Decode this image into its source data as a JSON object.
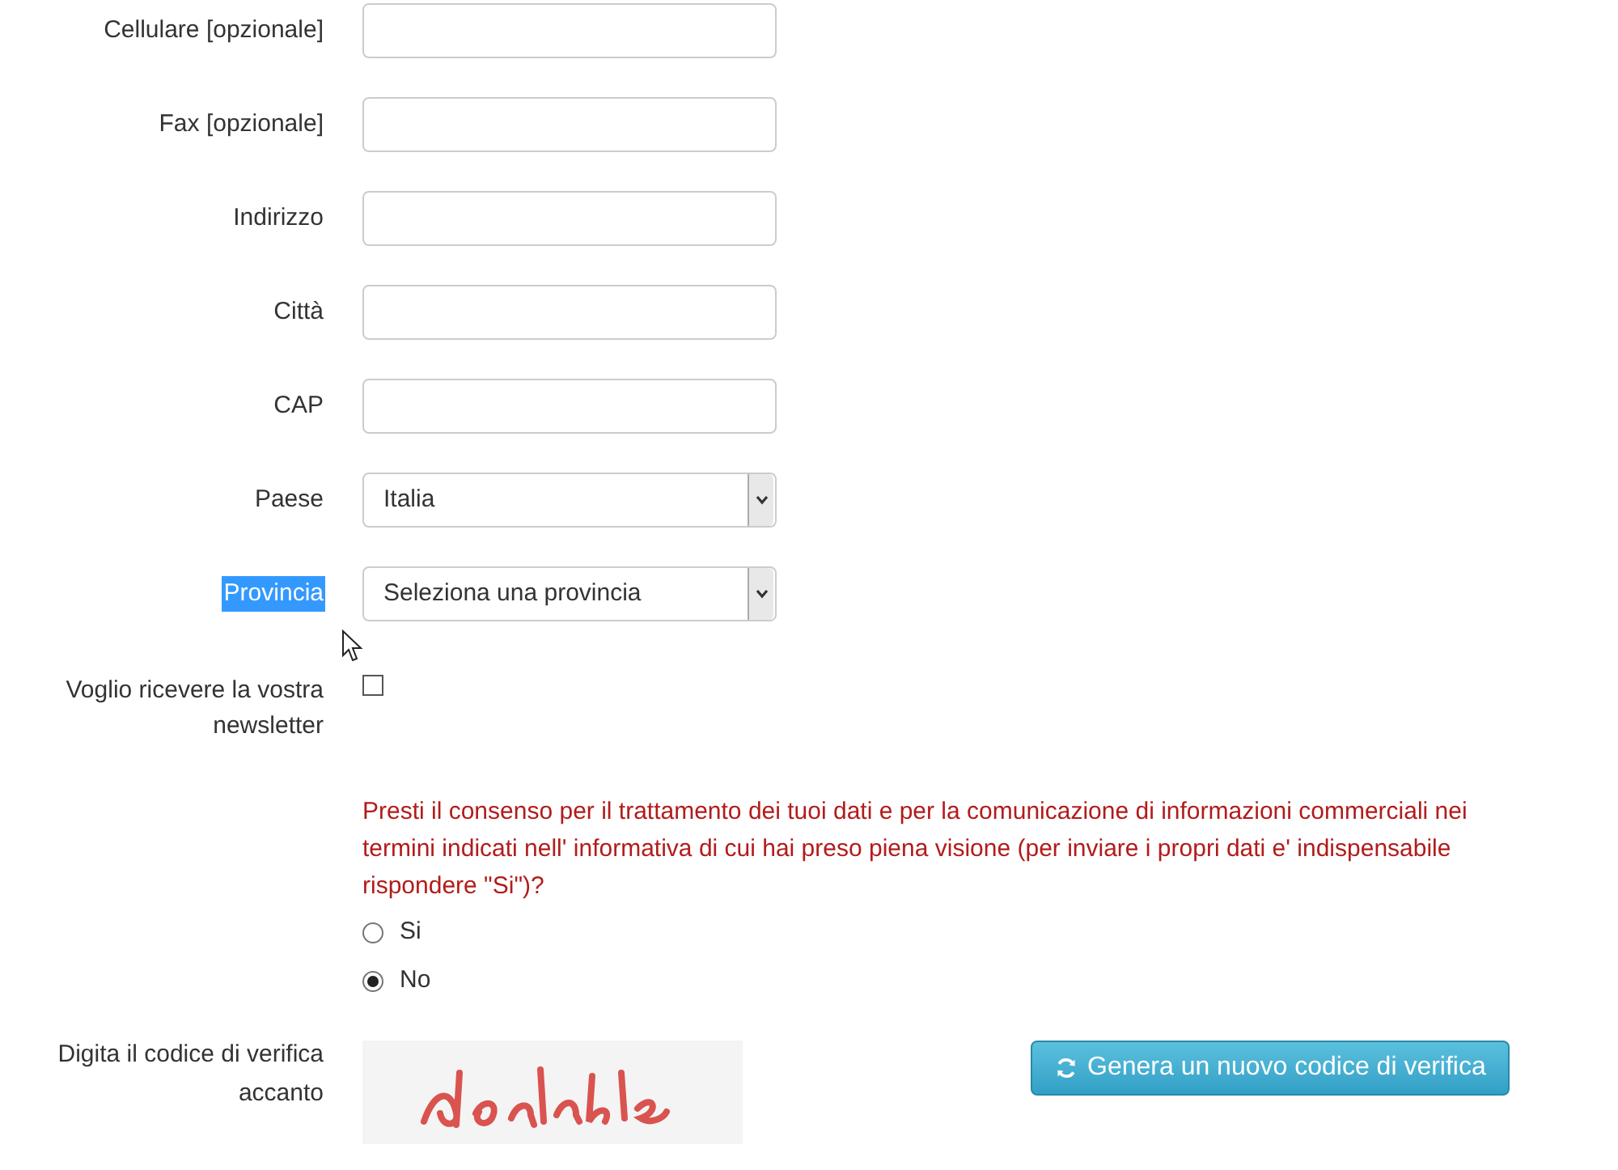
{
  "fields": [
    {
      "kind": "text",
      "label": "Cellulare [opzionale]"
    },
    {
      "kind": "text",
      "label": "Fax [opzionale]"
    },
    {
      "kind": "text",
      "label": "Indirizzo"
    },
    {
      "kind": "text",
      "label": "Città"
    },
    {
      "kind": "text",
      "label": "CAP"
    },
    {
      "kind": "select",
      "label": "Paese",
      "value": "Italia",
      "highlighted": false
    },
    {
      "kind": "select",
      "label": "Provincia",
      "value": "Seleziona una provincia",
      "highlighted": true
    }
  ],
  "newsletter": {
    "label": "Voglio ricevere la vostra newsletter",
    "checked": false
  },
  "consent": {
    "question": "Presti il consenso per il trattamento dei tuoi dati e per la comunicazione di informazioni commerciali nei termini indicati nell' informativa di cui hai preso piena visione (per inviare i propri dati e' indispensabile rispondere \"Si\")?",
    "options": [
      {
        "label": "Si",
        "selected": false
      },
      {
        "label": "No",
        "selected": true
      }
    ]
  },
  "captcha": {
    "label": "Digita il codice di verifica accanto",
    "button": "Genera un nuovo codice di verifica"
  }
}
